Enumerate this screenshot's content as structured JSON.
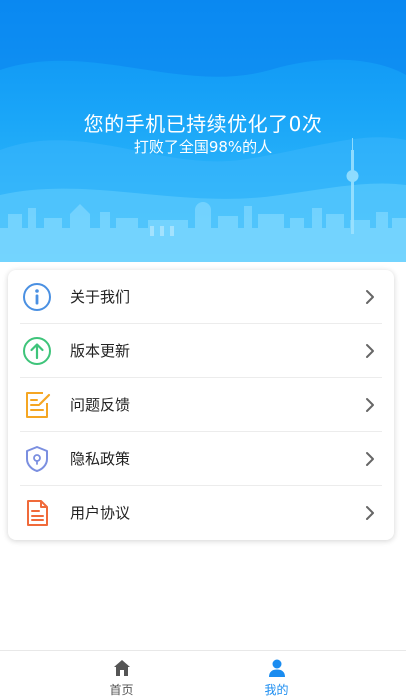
{
  "banner": {
    "headline": "您的手机已持续优化了0次",
    "subline": "打败了全国98%的人"
  },
  "menu": {
    "items": [
      {
        "label": "关于我们",
        "icon": "info-icon",
        "color": "#4a90e2"
      },
      {
        "label": "版本更新",
        "icon": "upload-arrow-icon",
        "color": "#3ec47a"
      },
      {
        "label": "问题反馈",
        "icon": "feedback-edit-icon",
        "color": "#f5a623"
      },
      {
        "label": "隐私政策",
        "icon": "shield-icon",
        "color": "#7b8fe0"
      },
      {
        "label": "用户协议",
        "icon": "document-icon",
        "color": "#f06a3a"
      }
    ]
  },
  "tabbar": {
    "tabs": [
      {
        "label": "首页",
        "icon": "home-icon",
        "active": false
      },
      {
        "label": "我的",
        "icon": "user-icon",
        "active": true
      }
    ],
    "active_color": "#1a8cf0",
    "inactive_color": "#555555"
  }
}
